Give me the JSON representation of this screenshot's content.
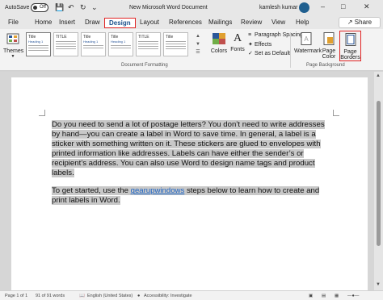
{
  "titlebar": {
    "autosave_label": "AutoSave",
    "autosave_state": "Off",
    "doc_title": "New Microsoft Word Document",
    "user": "kamlesh kumar",
    "qa_save": "💾",
    "qa_undo": "↶",
    "qa_redo": "↻",
    "qa_more": "⌄",
    "win_min": "–",
    "win_max": "□",
    "win_close": "✕"
  },
  "tabs": [
    "File",
    "Home",
    "Insert",
    "Draw",
    "Design",
    "Layout",
    "References",
    "Mailings",
    "Review",
    "View",
    "Help"
  ],
  "active_tab": "Design",
  "share_label": "Share",
  "ribbon": {
    "themes_label": "Themes",
    "style_title": "Title",
    "style_heading": "Heading 1",
    "style_title_caps": "TITLE",
    "colors_label": "Colors",
    "fonts_label": "Fonts",
    "paragraph_spacing": "Paragraph Spacing",
    "effects": "Effects",
    "set_as_default": "Set as Default",
    "watermark": "Watermark",
    "page_color_1": "Page",
    "page_color_2": "Color",
    "page_borders_1": "Page",
    "page_borders_2": "Borders",
    "group_doc_formatting": "Document Formatting",
    "group_page_background": "Page Background"
  },
  "document": {
    "para1": "Do you need to send a lot of postage letters? You don’t need to write addresses by hand—you can create a label in Word to save time. In general, a label is a sticker with something written on it. These stickers are glued to envelopes with printed information like addresses. Labels can have either the sender’s or recipient’s address. You can also use Word to design name tags and product labels.",
    "para2_before": "To get started, use the ",
    "para2_link": "gearupwindows",
    "para2_after": " steps below to learn how to create and print labels in Word."
  },
  "status": {
    "page": "Page 1 of 1",
    "words": "91 of 91 words",
    "language": "English (United States)",
    "accessibility": "Accessibility: Investigate"
  },
  "colors": {
    "accent_red": "#e02424",
    "link_blue": "#1a63c6",
    "selection_gray": "#c8c8c8"
  }
}
